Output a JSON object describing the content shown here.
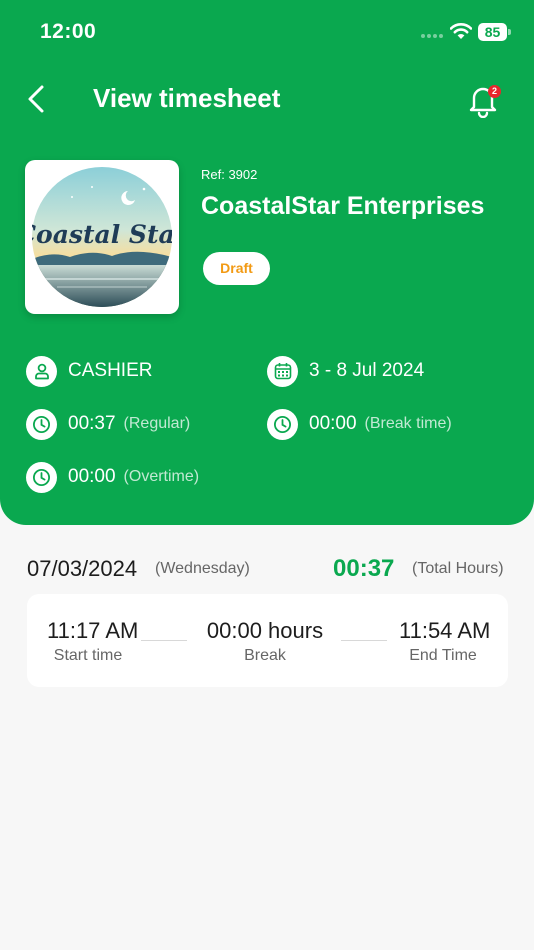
{
  "status_bar": {
    "time": "12:00",
    "battery": "85"
  },
  "nav": {
    "title": "View timesheet",
    "notification_count": "2"
  },
  "company": {
    "logo_text": "Coastal Star",
    "ref": "Ref: 3902",
    "name": "CoastalStar Enterprises",
    "status": "Draft"
  },
  "details": {
    "role": "CASHIER",
    "date_range": "3 - 8 Jul 2024",
    "regular_hours": "00:37",
    "regular_label": "(Regular)",
    "break_hours": "00:00",
    "break_label": "(Break time)",
    "overtime_hours": "00:00",
    "overtime_label": "(Overtime)"
  },
  "day": {
    "date": "07/03/2024",
    "weekday": "(Wednesday)",
    "total": "00:37",
    "total_label": "(Total Hours)",
    "start_time": "11:17 AM",
    "start_label": "Start time",
    "break_value": "00:00 hours",
    "break_label": "Break",
    "end_time": "11:54 AM",
    "end_label": "End Time"
  },
  "colors": {
    "primary": "#0aa84f",
    "draft": "#f29a14",
    "badge": "#e8262d"
  },
  "icons": [
    "wifi-icon",
    "battery-icon",
    "back-arrow-icon",
    "bell-icon",
    "user-icon",
    "calendar-icon",
    "clock-icon"
  ]
}
